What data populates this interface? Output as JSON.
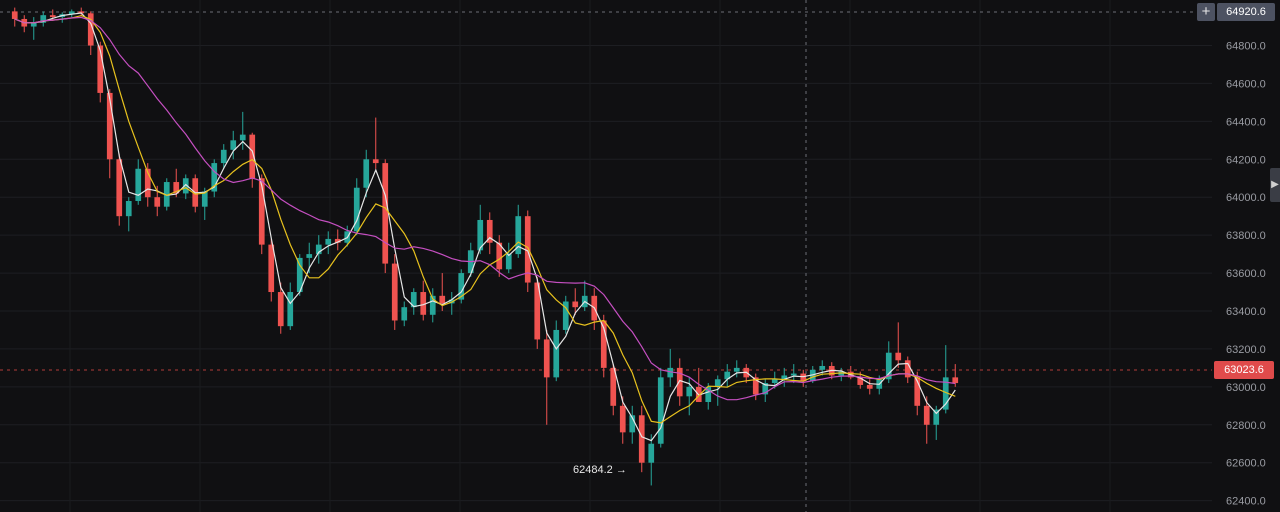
{
  "chart_data": {
    "type": "candlestick",
    "y_axis_ticks": [
      "64800.0",
      "64600.0",
      "64400.0",
      "64200.0",
      "64000.0",
      "63800.0",
      "63600.0",
      "63400.0",
      "63200.0",
      "63000.0",
      "62800.0",
      "62600.0",
      "62400.0"
    ],
    "y_axis_values": [
      64800,
      64600,
      64400,
      64200,
      64000,
      63800,
      63600,
      63400,
      63200,
      63000,
      62800,
      62600,
      62400
    ],
    "ylim": [
      62340,
      65040
    ],
    "crosshair_price": "64920.6",
    "last_price": "63023.6",
    "low_marker": "62484.2 →",
    "moving_averages": [
      {
        "color": "#e6e6e6"
      },
      {
        "color": "#e8c21e"
      },
      {
        "color": "#c54fc1"
      }
    ],
    "colors": {
      "up": "#26a69a",
      "down": "#ef5350"
    },
    "candles_ohlc": [
      [
        64980,
        65000,
        64900,
        64940
      ],
      [
        64940,
        64960,
        64870,
        64900
      ],
      [
        64900,
        64950,
        64830,
        64920
      ],
      [
        64920,
        64980,
        64900,
        64960
      ],
      [
        64960,
        64990,
        64930,
        64950
      ],
      [
        64950,
        64975,
        64920,
        64965
      ],
      [
        64965,
        64990,
        64950,
        64980
      ],
      [
        64980,
        65000,
        64960,
        64970
      ],
      [
        64970,
        64980,
        64750,
        64800
      ],
      [
        64800,
        64820,
        64500,
        64550
      ],
      [
        64550,
        64570,
        64100,
        64200
      ],
      [
        64200,
        64230,
        63850,
        63900
      ],
      [
        63900,
        64000,
        63820,
        63980
      ],
      [
        63980,
        64200,
        63960,
        64150
      ],
      [
        64150,
        64180,
        63950,
        64000
      ],
      [
        64000,
        64060,
        63900,
        63950
      ],
      [
        63950,
        64100,
        63930,
        64080
      ],
      [
        64080,
        64150,
        64000,
        64020
      ],
      [
        64020,
        64120,
        63990,
        64100
      ],
      [
        64100,
        64120,
        63920,
        63950
      ],
      [
        63950,
        64050,
        63880,
        64030
      ],
      [
        64030,
        64200,
        64000,
        64180
      ],
      [
        64180,
        64280,
        64150,
        64250
      ],
      [
        64250,
        64350,
        64200,
        64300
      ],
      [
        64300,
        64450,
        64250,
        64330
      ],
      [
        64330,
        64340,
        64050,
        64100
      ],
      [
        64100,
        64120,
        63700,
        63750
      ],
      [
        63750,
        63780,
        63450,
        63500
      ],
      [
        63500,
        63550,
        63280,
        63320
      ],
      [
        63320,
        63550,
        63300,
        63500
      ],
      [
        63500,
        63700,
        63480,
        63680
      ],
      [
        63680,
        63760,
        63600,
        63700
      ],
      [
        63700,
        63800,
        63650,
        63750
      ],
      [
        63750,
        63820,
        63700,
        63780
      ],
      [
        63780,
        63830,
        63720,
        63760
      ],
      [
        63760,
        63850,
        63740,
        63820
      ],
      [
        63820,
        64100,
        63800,
        64050
      ],
      [
        64050,
        64250,
        64000,
        64200
      ],
      [
        64200,
        64420,
        64150,
        64180
      ],
      [
        64180,
        64200,
        63600,
        63650
      ],
      [
        63650,
        63700,
        63300,
        63350
      ],
      [
        63350,
        63450,
        63320,
        63420
      ],
      [
        63420,
        63520,
        63380,
        63500
      ],
      [
        63500,
        63560,
        63350,
        63380
      ],
      [
        63380,
        63520,
        63340,
        63480
      ],
      [
        63480,
        63600,
        63400,
        63440
      ],
      [
        63440,
        63500,
        63380,
        63460
      ],
      [
        63460,
        63620,
        63440,
        63600
      ],
      [
        63600,
        63760,
        63580,
        63720
      ],
      [
        63720,
        63960,
        63700,
        63880
      ],
      [
        63880,
        63920,
        63700,
        63760
      ],
      [
        63760,
        63800,
        63580,
        63620
      ],
      [
        63620,
        63760,
        63600,
        63700
      ],
      [
        63700,
        63960,
        63680,
        63900
      ],
      [
        63900,
        63930,
        63500,
        63550
      ],
      [
        63550,
        63580,
        63200,
        63250
      ],
      [
        63250,
        63300,
        62800,
        63050
      ],
      [
        63050,
        63350,
        63030,
        63300
      ],
      [
        63300,
        63480,
        63280,
        63450
      ],
      [
        63450,
        63520,
        63380,
        63420
      ],
      [
        63420,
        63560,
        63400,
        63480
      ],
      [
        63480,
        63520,
        63300,
        63350
      ],
      [
        63350,
        63380,
        63050,
        63100
      ],
      [
        63100,
        63120,
        62850,
        62900
      ],
      [
        62900,
        62950,
        62700,
        62760
      ],
      [
        62760,
        62900,
        62700,
        62850
      ],
      [
        62850,
        62900,
        62550,
        62600
      ],
      [
        62600,
        62750,
        62480,
        62700
      ],
      [
        62700,
        63100,
        62680,
        63050
      ],
      [
        63050,
        63200,
        63000,
        63100
      ],
      [
        63100,
        63150,
        62900,
        62950
      ],
      [
        62950,
        63050,
        62850,
        63000
      ],
      [
        63000,
        63100,
        62950,
        62920
      ],
      [
        62920,
        63020,
        62880,
        63000
      ],
      [
        63000,
        63060,
        62900,
        63040
      ],
      [
        63040,
        63120,
        63000,
        63080
      ],
      [
        63080,
        63140,
        63050,
        63100
      ],
      [
        63100,
        63120,
        63020,
        63050
      ],
      [
        63050,
        63070,
        62930,
        62960
      ],
      [
        62960,
        63040,
        62920,
        63020
      ],
      [
        63020,
        63080,
        62990,
        63040
      ],
      [
        63040,
        63100,
        63000,
        63060
      ],
      [
        63060,
        63120,
        63020,
        63070
      ],
      [
        63070,
        63090,
        63000,
        63030
      ],
      [
        63030,
        63110,
        63020,
        63090
      ],
      [
        63090,
        63140,
        63060,
        63110
      ],
      [
        63110,
        63130,
        63040,
        63060
      ],
      [
        63060,
        63100,
        63030,
        63080
      ],
      [
        63080,
        63110,
        63040,
        63050
      ],
      [
        63050,
        63080,
        62990,
        63010
      ],
      [
        63010,
        63040,
        62960,
        62990
      ],
      [
        62990,
        63060,
        62960,
        63040
      ],
      [
        63040,
        63240,
        63020,
        63180
      ],
      [
        63180,
        63340,
        63100,
        63140
      ],
      [
        63140,
        63160,
        63020,
        63050
      ],
      [
        63050,
        63080,
        62850,
        62900
      ],
      [
        62900,
        62950,
        62700,
        62800
      ],
      [
        62800,
        62900,
        62720,
        62880
      ],
      [
        62880,
        63220,
        62860,
        63050
      ],
      [
        63050,
        63120,
        63000,
        63020
      ]
    ]
  }
}
